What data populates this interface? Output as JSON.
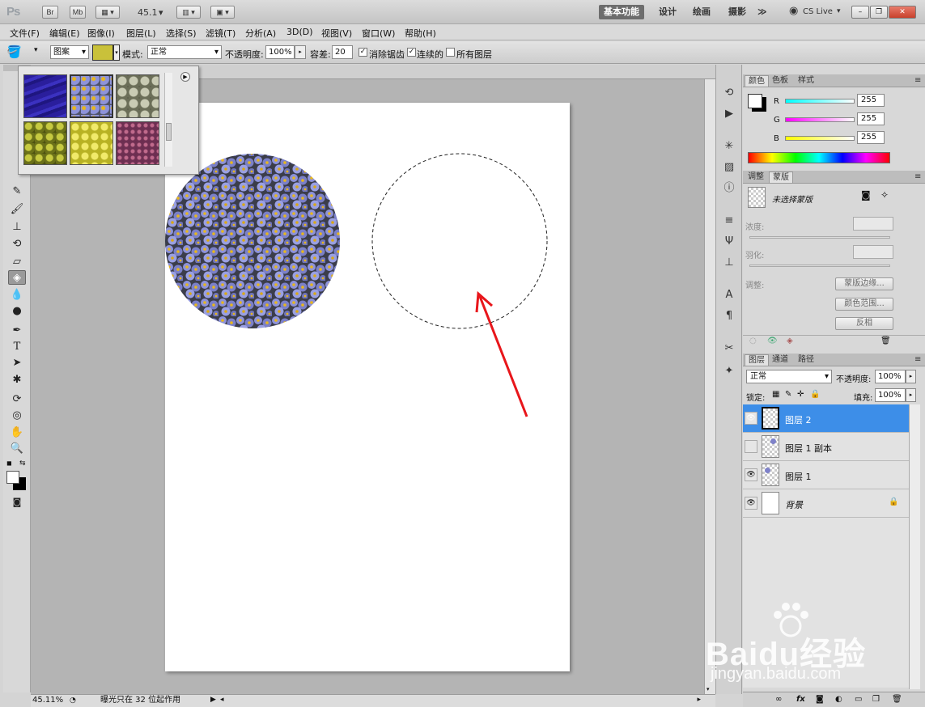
{
  "app": {
    "logo": "Ps",
    "bridge_btn": "Br",
    "minibridge_btn": "Mb",
    "zoom": "45.1"
  },
  "workspaces": [
    "基本功能",
    "设计",
    "绘画",
    "摄影"
  ],
  "workspace_more": "≫",
  "cslive": "CS Live",
  "menu": [
    "文件(F)",
    "编辑(E)",
    "图像(I)",
    "图层(L)",
    "选择(S)",
    "滤镜(T)",
    "分析(A)",
    "3D(D)",
    "视图(V)",
    "窗口(W)",
    "帮助(H)"
  ],
  "options": {
    "fill_source": "图案",
    "mode_label": "模式:",
    "mode_value": "正常",
    "opacity_label": "不透明度:",
    "opacity_value": "100%",
    "tolerance_label": "容差:",
    "tolerance_value": "20",
    "antialias_label": "消除锯齿",
    "antialias": true,
    "contiguous_label": "连续的",
    "contiguous": true,
    "all_layers_label": "所有图层",
    "all_layers": false
  },
  "pattern_swatches": [
    {
      "name": "blue-water",
      "color": "#2a1e9c"
    },
    {
      "name": "blue-flowers",
      "color": "#7f82c9"
    },
    {
      "name": "ivy-leaves",
      "color": "#8a8d73"
    },
    {
      "name": "yellow-green-leaves",
      "color": "#a2a52a"
    },
    {
      "name": "yellow-flowers",
      "color": "#d8d34a"
    },
    {
      "name": "purple-flowers",
      "color": "#7a3c5c"
    }
  ],
  "color_panel": {
    "tabs": [
      "颜色",
      "色板",
      "样式"
    ],
    "channels": [
      {
        "label": "R",
        "value": "255"
      },
      {
        "label": "G",
        "value": "255"
      },
      {
        "label": "B",
        "value": "255"
      }
    ]
  },
  "masks_panel": {
    "tabs": [
      "调整",
      "蒙版"
    ],
    "title": "未选择蒙版",
    "density_label": "浓度:",
    "feather_label": "羽化:",
    "refine_label": "调整:",
    "buttons": [
      "蒙版边缘...",
      "颜色范围...",
      "反相"
    ]
  },
  "layers_panel": {
    "tabs": [
      "图层",
      "通道",
      "路径"
    ],
    "blend_mode": "正常",
    "opacity_label": "不透明度:",
    "opacity_value": "100%",
    "lock_label": "锁定:",
    "fill_label": "填充:",
    "fill_value": "100%",
    "layers": [
      {
        "name": "图层 2",
        "visible": true,
        "selected": true
      },
      {
        "name": "图层 1 副本",
        "visible": false,
        "selected": false
      },
      {
        "name": "图层 1",
        "visible": true,
        "selected": false
      },
      {
        "name": "背景",
        "visible": true,
        "selected": false,
        "locked": true
      }
    ]
  },
  "status": {
    "zoom": "45.11%",
    "info": "曝光只在 32 位起作用"
  },
  "watermark": {
    "brand": "Baidu经验",
    "url": "jingyan.baidu.com"
  },
  "colors": {
    "selection": "#3d8ee8",
    "arrow": "#e8161b",
    "flower_base": "#8a8fd6",
    "flower_center": "#e7b71c"
  }
}
